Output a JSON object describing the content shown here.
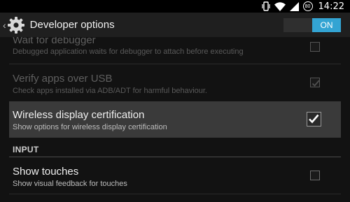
{
  "status_bar": {
    "time": "14:22",
    "battery_level": "80",
    "icons": [
      "vibrate-icon",
      "wifi-icon",
      "signal-icon",
      "battery-icon"
    ]
  },
  "action_bar": {
    "title": "Developer options",
    "icon": "gear-icon",
    "master_toggle": "ON"
  },
  "colors": {
    "accent": "#33a4d3",
    "selected_row": "#3a3a3a"
  },
  "preferences": [
    {
      "title": "Wait for debugger",
      "summary": "Debugged application waits for debugger to attach before executing",
      "checked": false,
      "enabled": false
    },
    {
      "title": "Verify apps over USB",
      "summary": "Check apps installed via ADB/ADT for harmful behaviour.",
      "checked": true,
      "enabled": false
    },
    {
      "title": "Wireless display certification",
      "summary": "Show options for wireless display certification",
      "checked": true,
      "enabled": true
    }
  ],
  "section": {
    "header": "INPUT",
    "items": [
      {
        "title": "Show touches",
        "summary": "Show visual feedback for touches",
        "checked": false,
        "enabled": true
      }
    ]
  }
}
